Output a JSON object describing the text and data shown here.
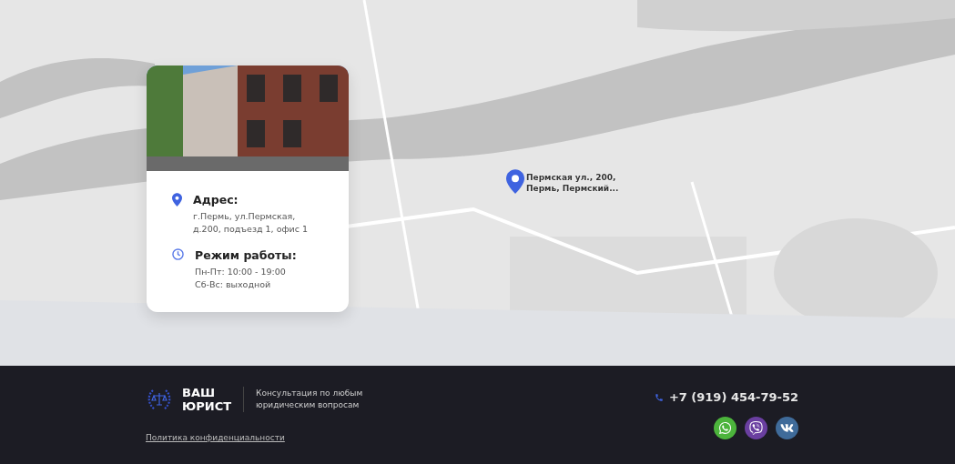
{
  "map": {
    "kind": "picture",
    "pin": {
      "label_lines": [
        "Пермская ул., 200,",
        "Пермь, Пермский..."
      ]
    }
  },
  "office_card": {
    "items": [
      {
        "kind": "address",
        "title": "Адрес:",
        "lines": [
          "г.Пермь,  ул.Пермская,",
          "д.200, подъезд 1, офис 1"
        ]
      },
      {
        "kind": "hours",
        "title": "Режим работы:",
        "lines": [
          "Пн-Пт: 10:00 - 19:00",
          "Сб-Вс: выходной"
        ]
      }
    ]
  },
  "footer": {
    "logo_lines": [
      "ВАШ",
      "ЮРИСТ"
    ],
    "tagline_lines": [
      "Консультация по любым",
      "юридическим вопросам"
    ],
    "privacy_link": "Политика конфиденциальности",
    "phone": "+7 (919) 454-79-52",
    "socials": [
      {
        "kind": "whatsapp",
        "color": "#4cb43c"
      },
      {
        "kind": "viber",
        "color": "#6a3fa0"
      },
      {
        "kind": "vk",
        "color": "#3f6b9a"
      }
    ]
  }
}
